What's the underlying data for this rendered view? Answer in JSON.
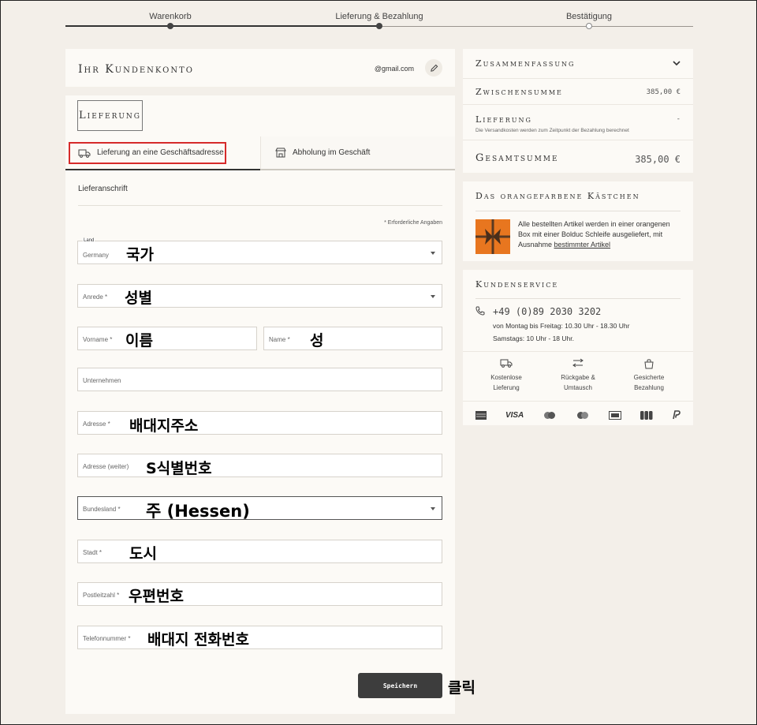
{
  "stepper": {
    "steps": [
      "Warenkorb",
      "Lieferung & Bezahlung",
      "Bestätigung"
    ]
  },
  "account": {
    "title": "Ihr Kundenkonto",
    "email": "@gmail.com"
  },
  "delivery": {
    "title": "Lieferung",
    "tabs": [
      "Lieferung an eine Geschäftsadresse",
      "Abholung im Geschäft"
    ],
    "section_label": "Lieferanschrift",
    "required_note": "* Erforderliche Angaben",
    "fields": {
      "country_label": "Land",
      "country_value": "Germany",
      "salutation": "Anrede *",
      "firstname": "Vorname *",
      "lastname": "Name *",
      "company": "Unternehmen",
      "address": "Adresse *",
      "address2": "Adresse (weiter)",
      "state": "Bundesland *",
      "city": "Stadt *",
      "zip": "Postleitzahl *",
      "phone": "Telefonnummer *"
    },
    "save_label": "Speichern"
  },
  "annotations": {
    "country": "국가",
    "salutation": "성별",
    "firstname": "이름",
    "lastname": "성",
    "address": "배대지주소",
    "address2": "S식별번호",
    "state": "주 (Hessen)",
    "city": "도시",
    "zip": "우편번호",
    "phone": "배대지 전화번호",
    "click": "클릭"
  },
  "summary": {
    "title": "Zusammenfassung",
    "subtotal_label": "Zwischensumme",
    "subtotal_value": "385,00 €",
    "delivery_label": "Lieferung",
    "delivery_value": "-",
    "delivery_note": "Die Versandkosten werden zum Zeitpunkt der Bezahlung berechnet",
    "total_label": "Gesamtsumme",
    "total_value": "385,00 €"
  },
  "orange_box": {
    "title": "Das orangefarbene Kästchen",
    "text": "Alle bestellten Artikel werden in einer orangenen Box mit einer Bolduc Schleife ausgeliefert, mit Ausnahme ",
    "link": "bestimmter Artikel"
  },
  "service": {
    "title": "Kundenservice",
    "phone": "+49 (0)89 2030 3202",
    "hours1": "von Montag bis Freitag: 10.30 Uhr - 18.30 Uhr",
    "hours2": "Samstags: 10 Uhr - 18 Uhr.",
    "items": [
      {
        "line1": "Kostenlose",
        "line2": "Lieferung"
      },
      {
        "line1": "Rückgabe &",
        "line2": "Umtausch"
      },
      {
        "line1": "Gesicherte",
        "line2": "Bezahlung"
      }
    ],
    "payments": [
      "VISA"
    ]
  },
  "colors": {
    "page_bg": "#f3efe9",
    "panel_bg": "#fcfaf6",
    "highlight": "#d62a2a",
    "button_bg": "#3d3d3d",
    "orange": "#e8761f"
  }
}
